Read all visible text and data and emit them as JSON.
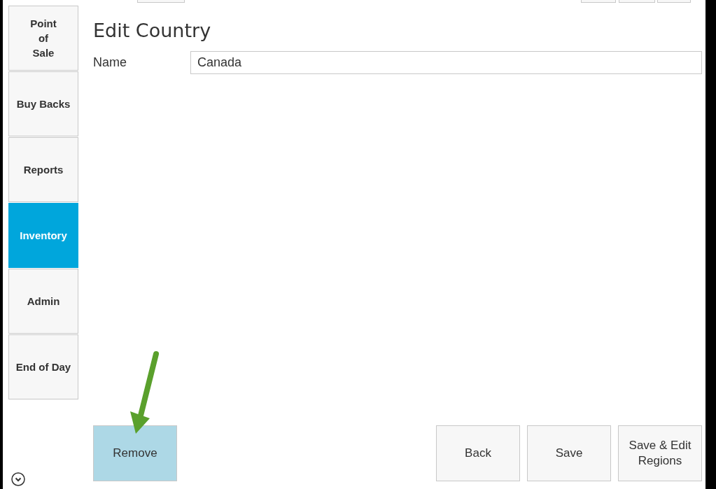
{
  "sidebar": {
    "items": [
      {
        "label": "Point\nof\nSale",
        "selected": false
      },
      {
        "label": "Buy Backs",
        "selected": false
      },
      {
        "label": "Reports",
        "selected": false
      },
      {
        "label": "Inventory",
        "selected": true
      },
      {
        "label": "Admin",
        "selected": false
      },
      {
        "label": "End of Day",
        "selected": false
      }
    ]
  },
  "page": {
    "title": "Edit Country",
    "fields": [
      {
        "label": "Name",
        "value": "Canada"
      }
    ]
  },
  "buttons": [
    {
      "label": "Remove",
      "highlighted": true
    },
    {
      "label": "Back",
      "highlighted": false
    },
    {
      "label": "Save",
      "highlighted": false
    },
    {
      "label": "Save & Edit\nRegions",
      "highlighted": false
    }
  ]
}
